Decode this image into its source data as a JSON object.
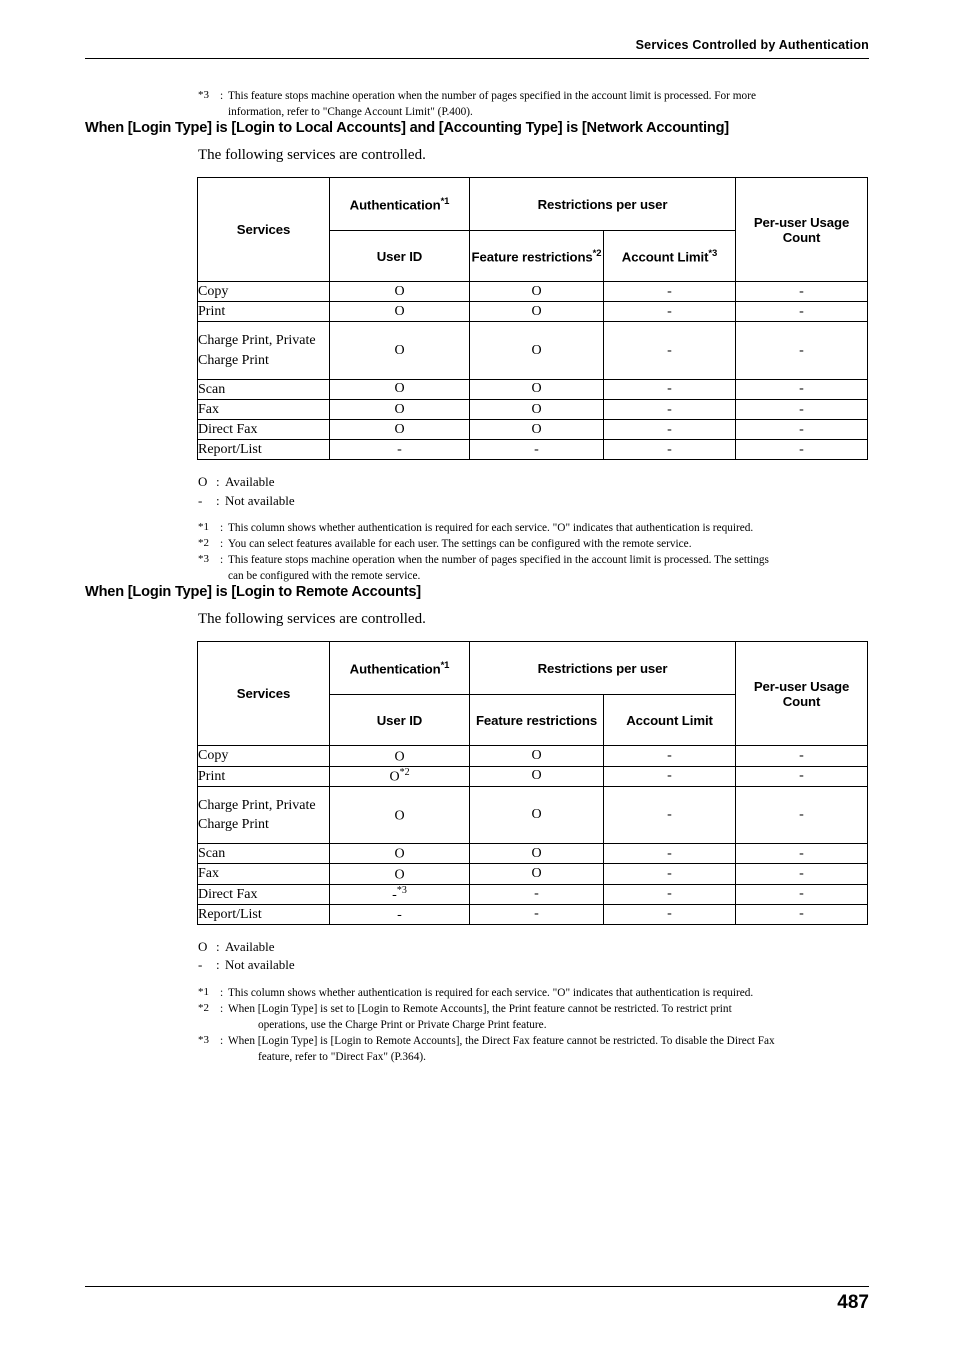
{
  "header": {
    "title": "Services Controlled by Authentication"
  },
  "footer": {
    "page_number": "487"
  },
  "top_note": {
    "mark": "*3",
    "colon": ":",
    "line1": "This feature stops machine operation when the number of pages specified in the account limit is processed. For more",
    "line2": "information, refer to \"Change Account Limit\" (P.400)."
  },
  "section1": {
    "title": "When [Login Type] is [Login to Local Accounts] and [Accounting Type] is [Network Accounting]",
    "intro": "The following services are controlled.",
    "table": {
      "headers": {
        "services": "Services",
        "authentication": "Authentication",
        "authentication_sup": "*1",
        "restrictions_per_user": "Restrictions per user",
        "per_user_usage_count": "Per-user Usage Count",
        "user_id": "User ID",
        "feature_restrictions": "Feature restrictions",
        "feature_restrictions_sup": "*2",
        "account_limit": "Account Limit",
        "account_limit_sup": "*3"
      },
      "rows": [
        {
          "service": "Copy",
          "user_id": "O",
          "feature": "O",
          "account": "-",
          "count": "-"
        },
        {
          "service": "Print",
          "user_id": "O",
          "feature": "O",
          "account": "-",
          "count": "-"
        },
        {
          "service": "Charge Print, Private Charge Print",
          "user_id": "O",
          "feature": "O",
          "account": "-",
          "count": "-"
        },
        {
          "service": "Scan",
          "user_id": "O",
          "feature": "O",
          "account": "-",
          "count": "-"
        },
        {
          "service": "Fax",
          "user_id": "O",
          "feature": "O",
          "account": "-",
          "count": "-"
        },
        {
          "service": "Direct Fax",
          "user_id": "O",
          "feature": "O",
          "account": "-",
          "count": "-"
        },
        {
          "service": "Report/List",
          "user_id": "-",
          "feature": "-",
          "account": "-",
          "count": "-"
        }
      ]
    },
    "legend": [
      {
        "key": "O",
        "colon": ":",
        "text": "Available"
      },
      {
        "key": "-",
        "colon": ":",
        "text": "Not available"
      }
    ],
    "notes": [
      {
        "mark": "*1",
        "colon": ":",
        "line1": "This column shows whether authentication is required for each service. \"O\" indicates that authentication is required.",
        "line2": ""
      },
      {
        "mark": "*2",
        "colon": ":",
        "line1": "You can select features available for each user. The settings can be configured with the remote service.",
        "line2": ""
      },
      {
        "mark": "*3",
        "colon": ":",
        "line1": "This feature stops machine operation when the number of pages specified in the account limit is processed. The settings",
        "line2": "can be configured with the remote service."
      }
    ]
  },
  "section2": {
    "title": "When [Login Type] is [Login to Remote Accounts]",
    "intro": "The following services are controlled.",
    "table": {
      "headers": {
        "services": "Services",
        "authentication": "Authentication",
        "authentication_sup": "*1",
        "restrictions_per_user": "Restrictions per user",
        "per_user_usage_count": "Per-user Usage Count",
        "user_id": "User ID",
        "feature_restrictions": "Feature restrictions",
        "account_limit": "Account Limit"
      },
      "rows": [
        {
          "service": "Copy",
          "user_id": "O",
          "user_id_sup": "",
          "feature": "O",
          "account": "-",
          "count": "-"
        },
        {
          "service": "Print",
          "user_id": "O",
          "user_id_sup": "*2",
          "feature": "O",
          "account": "-",
          "count": "-"
        },
        {
          "service": "Charge Print, Private Charge Print",
          "user_id": "O",
          "user_id_sup": "",
          "feature": "O",
          "account": "-",
          "count": "-"
        },
        {
          "service": "Scan",
          "user_id": "O",
          "user_id_sup": "",
          "feature": "O",
          "account": "-",
          "count": "-"
        },
        {
          "service": "Fax",
          "user_id": "O",
          "user_id_sup": "",
          "feature": "O",
          "account": "-",
          "count": "-"
        },
        {
          "service": "Direct Fax",
          "user_id": "-",
          "user_id_sup": "*3",
          "feature": "-",
          "account": "-",
          "count": "-"
        },
        {
          "service": "Report/List",
          "user_id": "-",
          "user_id_sup": "",
          "feature": "-",
          "account": "-",
          "count": "-"
        }
      ]
    },
    "legend": [
      {
        "key": "O",
        "colon": ":",
        "text": "Available"
      },
      {
        "key": "-",
        "colon": ":",
        "text": "Not available"
      }
    ],
    "notes": [
      {
        "mark": "*1",
        "colon": ":",
        "line1": "This column shows whether authentication is required for each service. \"O\" indicates that authentication is required.",
        "line2": ""
      },
      {
        "mark": "*2",
        "colon": ":",
        "line1": "When [Login Type] is set to [Login to Remote Accounts], the Print feature cannot be restricted. To restrict print",
        "line2": "operations, use the Charge Print or Private Charge Print feature."
      },
      {
        "mark": "*3",
        "colon": ":",
        "line1": "When [Login Type] is [Login to Remote Accounts], the Direct Fax feature cannot be restricted. To disable the Direct Fax",
        "line2": "feature, refer to \"Direct Fax\" (P.364)."
      }
    ]
  }
}
